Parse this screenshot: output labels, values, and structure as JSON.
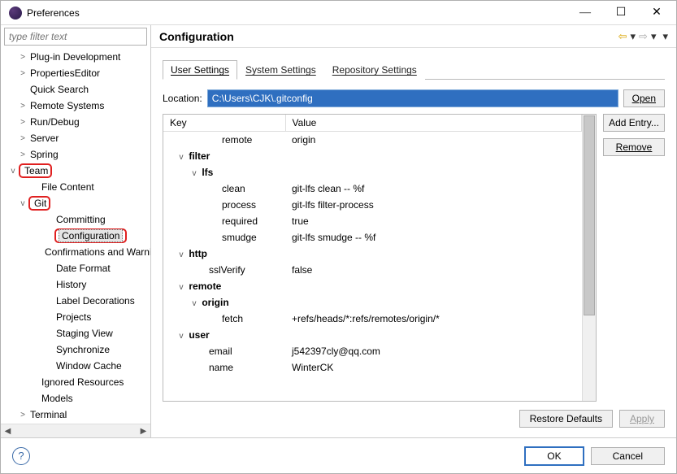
{
  "window": {
    "title": "Preferences"
  },
  "filter": {
    "placeholder": "type filter text"
  },
  "tree": [
    {
      "label": "Plug-in Development",
      "indent": 20,
      "exp": ">"
    },
    {
      "label": "PropertiesEditor",
      "indent": 20,
      "exp": ">"
    },
    {
      "label": "Quick Search",
      "indent": 20,
      "exp": ""
    },
    {
      "label": "Remote Systems",
      "indent": 20,
      "exp": ">"
    },
    {
      "label": "Run/Debug",
      "indent": 20,
      "exp": ">"
    },
    {
      "label": "Server",
      "indent": 20,
      "exp": ">"
    },
    {
      "label": "Spring",
      "indent": 20,
      "exp": ">"
    },
    {
      "label": "Team",
      "indent": 8,
      "exp": "v",
      "redbox": true
    },
    {
      "label": "File Content",
      "indent": 34,
      "exp": ""
    },
    {
      "label": "Git",
      "indent": 20,
      "exp": "v",
      "redbox": true
    },
    {
      "label": "Committing",
      "indent": 52,
      "exp": ""
    },
    {
      "label": "Configuration",
      "indent": 52,
      "exp": "",
      "selected": true,
      "redbox": true
    },
    {
      "label": "Confirmations and Warnings",
      "indent": 52,
      "exp": ""
    },
    {
      "label": "Date Format",
      "indent": 52,
      "exp": ""
    },
    {
      "label": "History",
      "indent": 52,
      "exp": ""
    },
    {
      "label": "Label Decorations",
      "indent": 52,
      "exp": ""
    },
    {
      "label": "Projects",
      "indent": 52,
      "exp": ""
    },
    {
      "label": "Staging View",
      "indent": 52,
      "exp": ""
    },
    {
      "label": "Synchronize",
      "indent": 52,
      "exp": ""
    },
    {
      "label": "Window Cache",
      "indent": 52,
      "exp": ""
    },
    {
      "label": "Ignored Resources",
      "indent": 34,
      "exp": ""
    },
    {
      "label": "Models",
      "indent": 34,
      "exp": ""
    },
    {
      "label": "Terminal",
      "indent": 20,
      "exp": ">"
    }
  ],
  "page": {
    "title": "Configuration",
    "tabs": [
      "User Settings",
      "System Settings",
      "Repository Settings"
    ],
    "location_label": "Location:",
    "location_value": "C:\\Users\\CJK\\.gitconfig",
    "open": "Open",
    "table": {
      "headers": [
        "Key",
        "Value"
      ],
      "rows": [
        {
          "k": "remote",
          "v": "origin",
          "ind": 64,
          "exp": ""
        },
        {
          "k": "filter",
          "v": "",
          "ind": 8,
          "exp": "v",
          "bold": true
        },
        {
          "k": "lfs",
          "v": "",
          "ind": 24,
          "exp": "v",
          "bold": true
        },
        {
          "k": "clean",
          "v": "git-lfs clean -- %f",
          "ind": 64,
          "exp": ""
        },
        {
          "k": "process",
          "v": "git-lfs filter-process",
          "ind": 64,
          "exp": ""
        },
        {
          "k": "required",
          "v": "true",
          "ind": 64,
          "exp": ""
        },
        {
          "k": "smudge",
          "v": "git-lfs smudge -- %f",
          "ind": 64,
          "exp": ""
        },
        {
          "k": "http",
          "v": "",
          "ind": 8,
          "exp": "v",
          "bold": true
        },
        {
          "k": "sslVerify",
          "v": "false",
          "ind": 48,
          "exp": ""
        },
        {
          "k": "remote",
          "v": "",
          "ind": 8,
          "exp": "v",
          "bold": true
        },
        {
          "k": "origin",
          "v": "",
          "ind": 24,
          "exp": "v",
          "bold": true
        },
        {
          "k": "fetch",
          "v": "+refs/heads/*:refs/remotes/origin/*",
          "ind": 64,
          "exp": ""
        },
        {
          "k": "user",
          "v": "",
          "ind": 8,
          "exp": "v",
          "bold": true
        },
        {
          "k": "email",
          "v": "j542397cly@qq.com",
          "ind": 48,
          "exp": ""
        },
        {
          "k": "name",
          "v": "WinterCK",
          "ind": 48,
          "exp": ""
        }
      ]
    },
    "add_entry": "Add Entry...",
    "remove": "Remove",
    "restore": "Restore Defaults",
    "apply": "Apply"
  },
  "footer": {
    "ok": "OK",
    "cancel": "Cancel"
  }
}
